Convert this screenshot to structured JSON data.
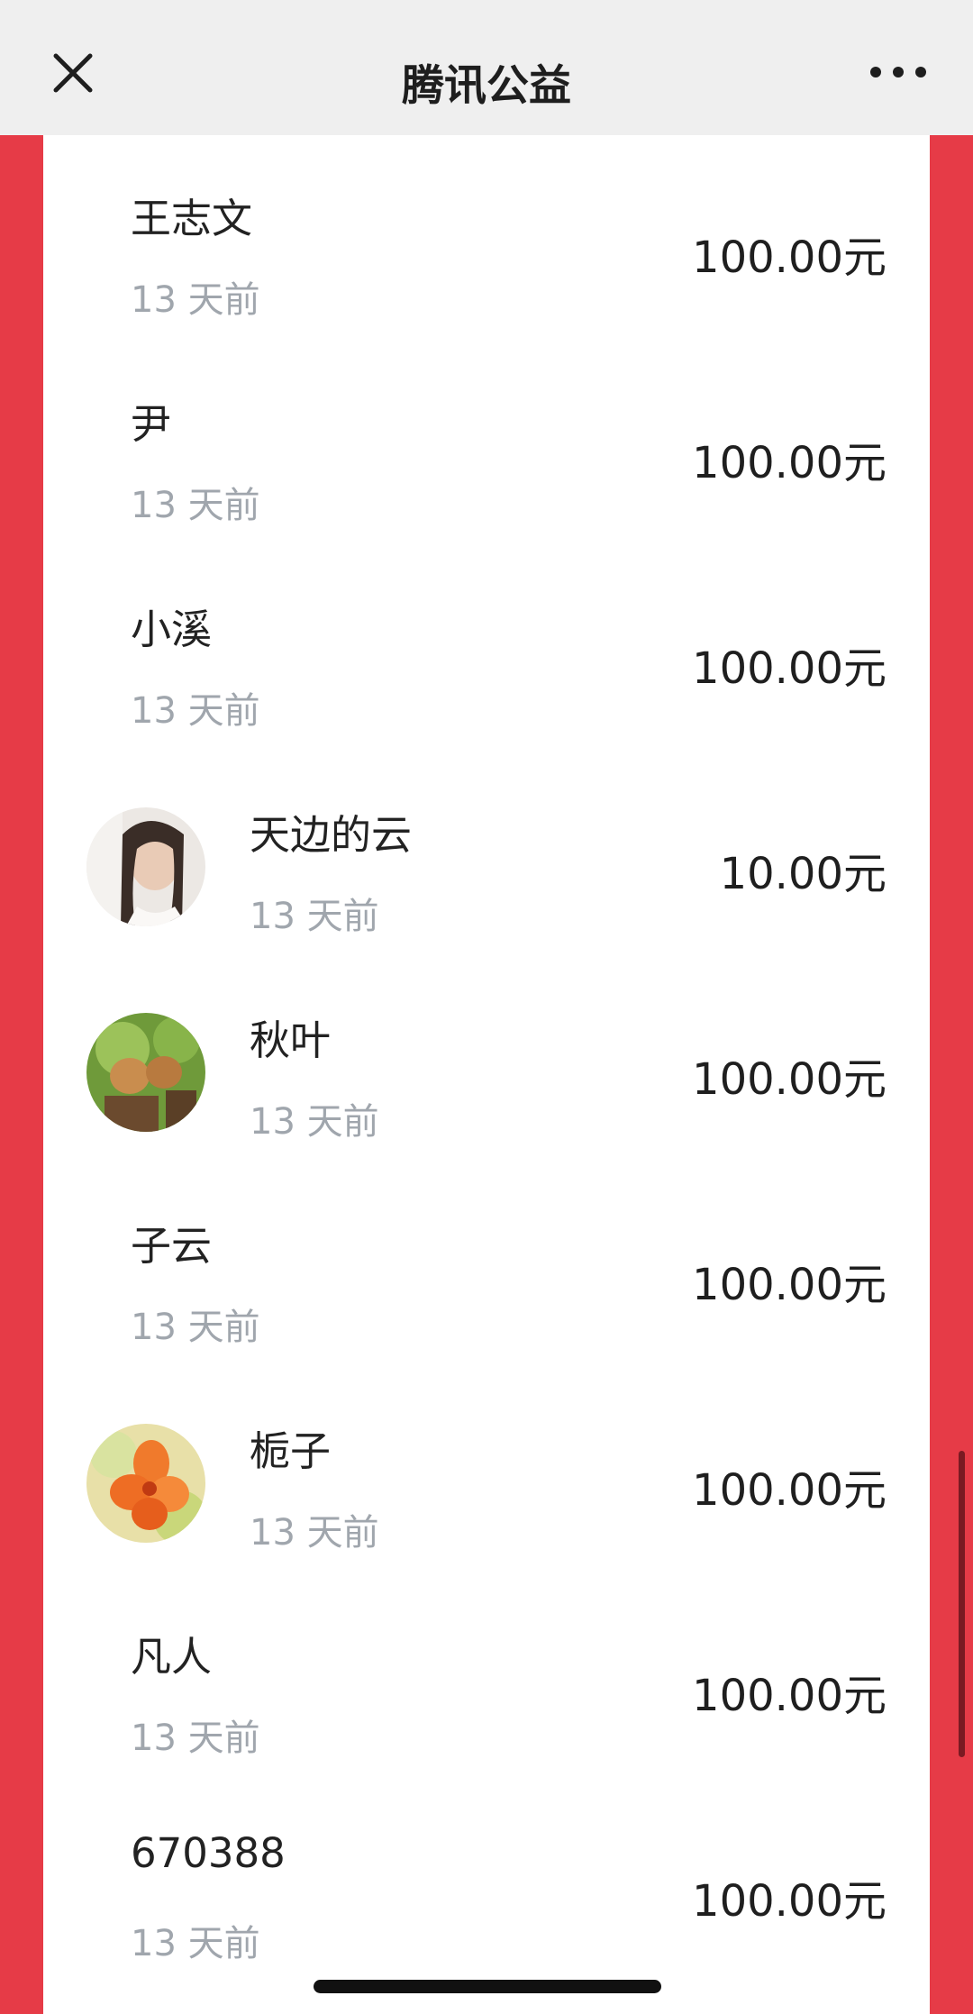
{
  "header": {
    "title": "腾讯公益",
    "close_icon": "close-icon",
    "more_icon": "more-dots-icon"
  },
  "donations": [
    {
      "name": "王志文",
      "time": "13 天前",
      "amount": "100.00元",
      "avatar": null
    },
    {
      "name": "尹",
      "time": "13 天前",
      "amount": "100.00元",
      "avatar": null
    },
    {
      "name": "小溪",
      "time": "13 天前",
      "amount": "100.00元",
      "avatar": null
    },
    {
      "name": "天边的云",
      "time": "13 天前",
      "amount": "10.00元",
      "avatar": "portrait-woman"
    },
    {
      "name": "秋叶",
      "time": "13 天前",
      "amount": "100.00元",
      "avatar": "puppies-photo"
    },
    {
      "name": "子云",
      "time": "13 天前",
      "amount": "100.00元",
      "avatar": null
    },
    {
      "name": "栀子",
      "time": "13 天前",
      "amount": "100.00元",
      "avatar": "orange-flower-photo"
    },
    {
      "name": "凡人",
      "time": "13 天前",
      "amount": "100.00元",
      "avatar": null
    },
    {
      "name": "670388",
      "time": "13 天前",
      "amount": "100.00元",
      "avatar": null
    }
  ],
  "colors": {
    "side_background": "#e63b47",
    "navbar_background": "#efefef",
    "card_background": "#ffffff",
    "name_text": "#222222",
    "time_text": "#a0a6ad"
  }
}
